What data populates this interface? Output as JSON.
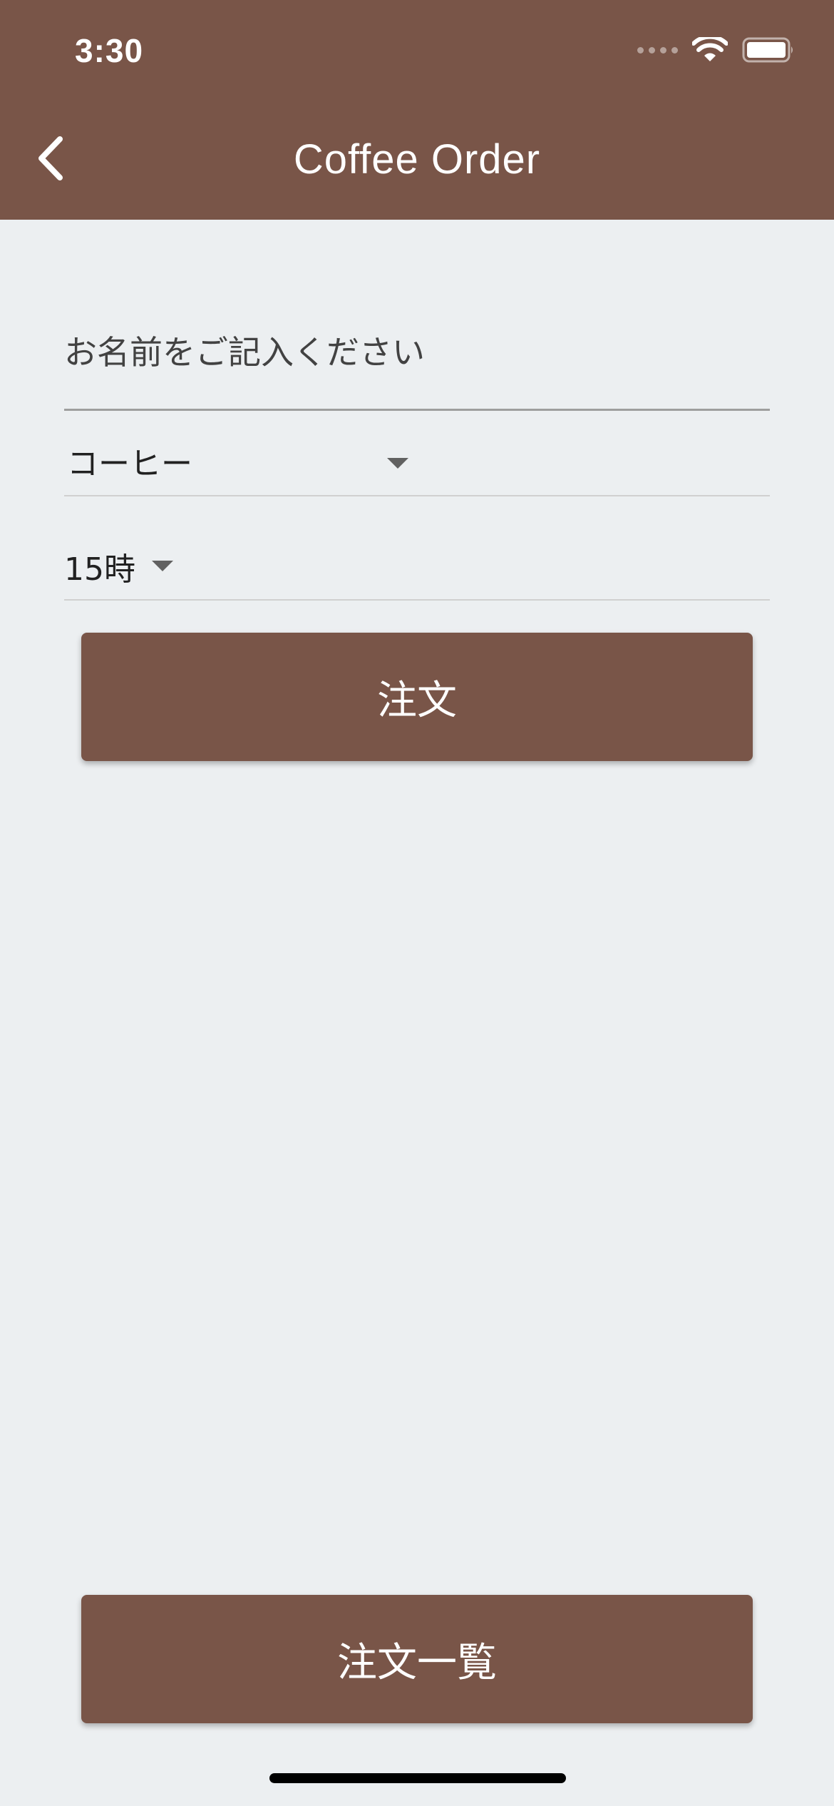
{
  "status_bar": {
    "time": "3:30",
    "icons": [
      "signal-dots-icon",
      "wifi-icon",
      "battery-icon"
    ]
  },
  "app_bar": {
    "title": "Coffee Order",
    "back_icon": "chevron-left-icon",
    "background_color": "#795548"
  },
  "form": {
    "name_field": {
      "placeholder": "お名前をご記入ください",
      "value": ""
    },
    "coffee_dropdown": {
      "selected": "コーヒー"
    },
    "time_dropdown": {
      "selected": "15時"
    },
    "order_button_label": "注文"
  },
  "footer": {
    "order_list_button_label": "注文一覧"
  },
  "colors": {
    "primary": "#795548",
    "background": "#ECEFF1",
    "on_primary": "#FFFFFF"
  }
}
